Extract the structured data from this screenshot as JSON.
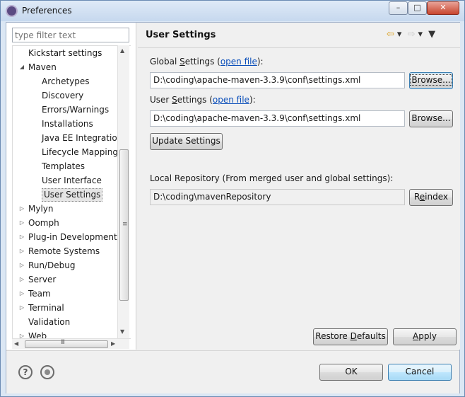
{
  "window": {
    "title": "Preferences",
    "minimize_glyph": "–",
    "maximize_glyph": "□",
    "close_glyph": "✕"
  },
  "filter": {
    "placeholder": "type filter text",
    "value": ""
  },
  "tree": {
    "items": [
      {
        "label": "Kickstart settings",
        "level": 1,
        "twisty": ""
      },
      {
        "label": "Maven",
        "level": 0,
        "twisty": "expanded"
      },
      {
        "label": "Archetypes",
        "level": 2,
        "twisty": ""
      },
      {
        "label": "Discovery",
        "level": 2,
        "twisty": ""
      },
      {
        "label": "Errors/Warnings",
        "level": 2,
        "twisty": ""
      },
      {
        "label": "Installations",
        "level": 2,
        "twisty": ""
      },
      {
        "label": "Java EE Integratio",
        "level": 2,
        "twisty": ""
      },
      {
        "label": "Lifecycle Mapping",
        "level": 2,
        "twisty": ""
      },
      {
        "label": "Templates",
        "level": 2,
        "twisty": ""
      },
      {
        "label": "User Interface",
        "level": 2,
        "twisty": ""
      },
      {
        "label": "User Settings",
        "level": 2,
        "twisty": "",
        "selected": true
      },
      {
        "label": "Mylyn",
        "level": 0,
        "twisty": "collapsed"
      },
      {
        "label": "Oomph",
        "level": 0,
        "twisty": "collapsed"
      },
      {
        "label": "Plug-in Development",
        "level": 0,
        "twisty": "collapsed"
      },
      {
        "label": "Remote Systems",
        "level": 0,
        "twisty": "collapsed"
      },
      {
        "label": "Run/Debug",
        "level": 0,
        "twisty": "collapsed"
      },
      {
        "label": "Server",
        "level": 0,
        "twisty": "collapsed"
      },
      {
        "label": "Team",
        "level": 0,
        "twisty": "collapsed"
      },
      {
        "label": "Terminal",
        "level": 0,
        "twisty": "collapsed"
      },
      {
        "label": "Validation",
        "level": 0,
        "twisty": ""
      },
      {
        "label": "Web",
        "level": 0,
        "twisty": "collapsed"
      }
    ],
    "scroll_grip": "≡",
    "hscroll_grip": "III"
  },
  "page": {
    "title": "User Settings",
    "global_label_pre": "Global ",
    "global_label_mn": "S",
    "global_label_rest": "ettings (",
    "global_link": "open file",
    "global_label_post": "):",
    "global_path": "D:\\coding\\apache-maven-3.3.9\\conf\\settings.xml",
    "user_label_pre": "User ",
    "user_label_mn": "S",
    "user_label_rest": "ettings (",
    "user_link": "open file",
    "user_label_post": "):",
    "user_path": "D:\\coding\\apache-maven-3.3.9\\conf\\settings.xml",
    "browse_label": "Browse...",
    "update_label": "Update Settings",
    "local_repo_label": "Local Repository (From merged user and global settings):",
    "local_repo_path": "D:\\coding\\mavenRepository",
    "reindex_pre": "R",
    "reindex_mn": "e",
    "reindex_post": "index",
    "restore_pre": "Restore ",
    "restore_mn": "D",
    "restore_post": "efaults",
    "apply_pre": "",
    "apply_mn": "A",
    "apply_post": "pply"
  },
  "footer": {
    "help_glyph": "?",
    "ok_label": "OK",
    "cancel_label": "Cancel"
  },
  "colors": {
    "link": "#0b4fba",
    "selection": "#e5e5e5",
    "default_button": "#a7d9f5"
  }
}
